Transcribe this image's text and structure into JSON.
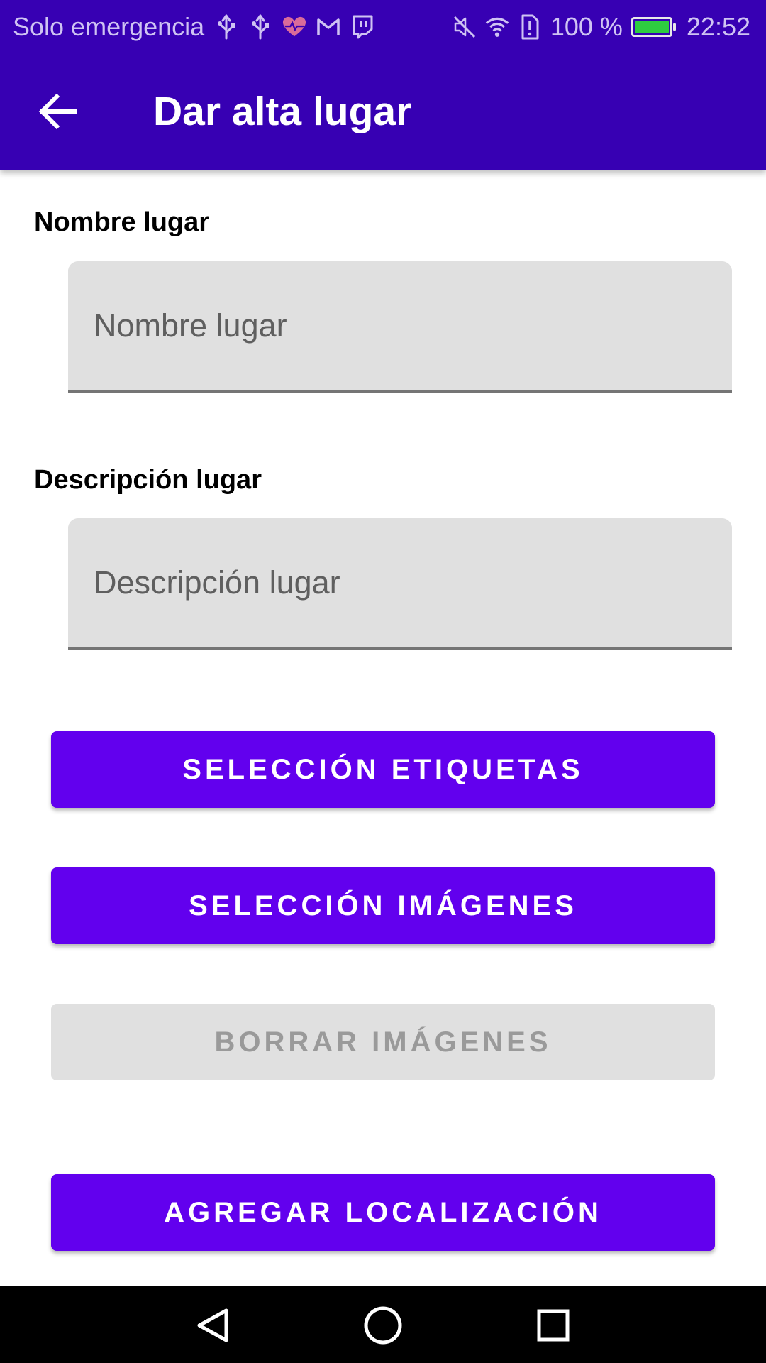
{
  "status_bar": {
    "carrier": "Solo emergencia",
    "battery_percent": "100 %",
    "time": "22:52",
    "left_icons": [
      "usb-icon",
      "usb-icon",
      "heart-pulse-icon",
      "gmail-icon",
      "twitch-icon"
    ],
    "right_icons": [
      "mute-icon",
      "wifi-icon",
      "sim-alert-icon",
      "battery-charging-icon"
    ],
    "colors": {
      "battery_fill": "#2ecc40"
    }
  },
  "app_bar": {
    "title": "Dar alta lugar",
    "back_icon": "arrow-back-icon",
    "color": "#3700B3"
  },
  "form": {
    "name_label": "Nombre lugar",
    "name_placeholder": "Nombre lugar",
    "name_value": "",
    "description_label": "Descripción lugar",
    "description_placeholder": "Descripción lugar",
    "description_value": ""
  },
  "buttons": {
    "select_tags": "SELECCIÓN ETIQUETAS",
    "select_images": "SELECCIÓN IMÁGENES",
    "delete_images": "BORRAR IMÁGENES",
    "delete_images_enabled": false,
    "add_location": "AGREGAR LOCALIZACIÓN",
    "primary_color": "#6200EE",
    "disabled_color": "#e0e0e0"
  },
  "nav_bar": {
    "icons": [
      "nav-back-icon",
      "nav-home-icon",
      "nav-recents-icon"
    ]
  }
}
